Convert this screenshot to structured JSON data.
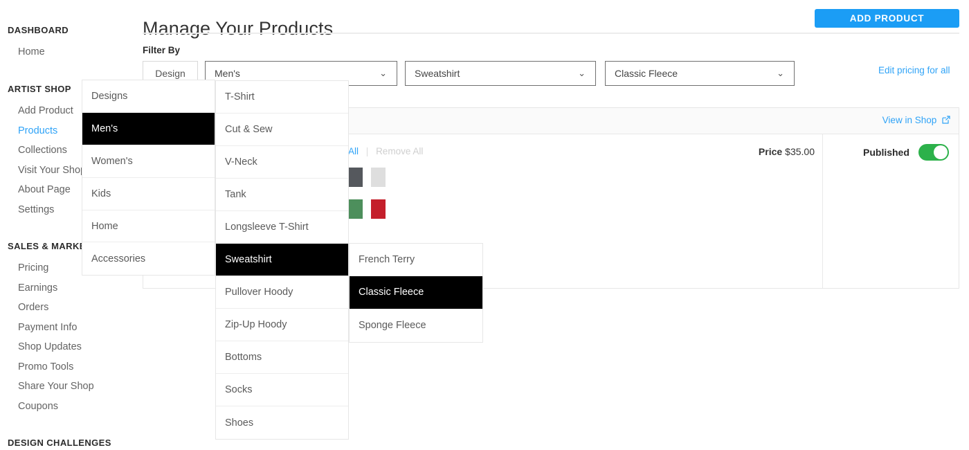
{
  "sidebar": {
    "groups": [
      {
        "title": "DASHBOARD",
        "items": [
          {
            "label": "Home",
            "active": false
          }
        ]
      },
      {
        "title": "ARTIST SHOP",
        "items": [
          {
            "label": "Add Product",
            "active": false
          },
          {
            "label": "Products",
            "active": true
          },
          {
            "label": "Collections",
            "active": false
          },
          {
            "label": "Visit Your Shop",
            "active": false
          },
          {
            "label": "About Page",
            "active": false
          },
          {
            "label": "Settings",
            "active": false
          }
        ]
      },
      {
        "title": "SALES & MARKETING",
        "items": [
          {
            "label": "Pricing",
            "active": false
          },
          {
            "label": "Earnings",
            "active": false
          },
          {
            "label": "Orders",
            "active": false
          },
          {
            "label": "Payment Info",
            "active": false
          },
          {
            "label": "Shop Updates",
            "active": false
          },
          {
            "label": "Promo Tools",
            "active": false
          },
          {
            "label": "Share Your Shop",
            "active": false
          },
          {
            "label": "Coupons",
            "active": false
          }
        ]
      },
      {
        "title": "DESIGN CHALLENGES",
        "items": []
      }
    ]
  },
  "header": {
    "title": "Manage Your Products",
    "add_product_label": "ADD PRODUCT"
  },
  "filters": {
    "label": "Filter By",
    "design_button": "Design",
    "category_value": "Men's",
    "product_value": "Sweatshirt",
    "material_value": "Classic Fleece",
    "chevron": "⌄",
    "edit_pricing_link": "Edit pricing for all"
  },
  "product_card": {
    "view_in_shop": "View in Shop",
    "select_all": "All",
    "remove_all": "Remove All",
    "price_label": "Price",
    "price_value": "$35.00",
    "published_label": "Published",
    "published_on": true,
    "colors": [
      {
        "name": "charcoal",
        "hex": "#55585d"
      },
      {
        "name": "light-grey",
        "hex": "#dedede"
      },
      {
        "name": "green",
        "hex": "#4d8f5c"
      },
      {
        "name": "red",
        "hex": "#c41f2b"
      }
    ]
  },
  "menus": {
    "column1": {
      "items": [
        {
          "label": "Designs",
          "selected": false
        },
        {
          "label": "Men's",
          "selected": true
        },
        {
          "label": "Women's",
          "selected": false
        },
        {
          "label": "Kids",
          "selected": false
        },
        {
          "label": "Home",
          "selected": false
        },
        {
          "label": "Accessories",
          "selected": false
        }
      ]
    },
    "column2": {
      "items": [
        {
          "label": "T-Shirt",
          "selected": false
        },
        {
          "label": "Cut & Sew",
          "selected": false
        },
        {
          "label": "V-Neck",
          "selected": false
        },
        {
          "label": "Tank",
          "selected": false
        },
        {
          "label": "Longsleeve T-Shirt",
          "selected": false
        },
        {
          "label": "Sweatshirt",
          "selected": true
        },
        {
          "label": "Pullover Hoody",
          "selected": false
        },
        {
          "label": "Zip-Up Hoody",
          "selected": false
        },
        {
          "label": "Bottoms",
          "selected": false
        },
        {
          "label": "Socks",
          "selected": false
        },
        {
          "label": "Shoes",
          "selected": false
        }
      ]
    },
    "column3": {
      "items": [
        {
          "label": "French Terry",
          "selected": false
        },
        {
          "label": "Classic Fleece",
          "selected": true
        },
        {
          "label": "Sponge Fleece",
          "selected": false
        }
      ]
    }
  }
}
